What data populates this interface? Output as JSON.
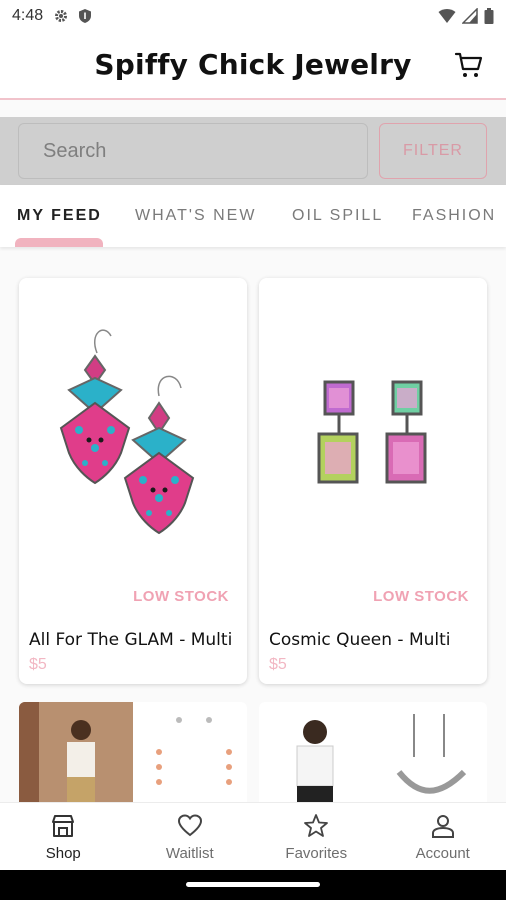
{
  "status_bar": {
    "time": "4:48"
  },
  "app_bar": {
    "title": "Spiffy Chick Jewelry"
  },
  "search": {
    "placeholder": "Search",
    "filter_label": "FILTER"
  },
  "tabs": [
    {
      "label": "MY FEED"
    },
    {
      "label": "WHAT'S NEW"
    },
    {
      "label": "OIL SPILL"
    },
    {
      "label": "FASHION"
    }
  ],
  "products": [
    {
      "name": "All For The GLAM - Multi",
      "price": "$5",
      "stock": "LOW STOCK"
    },
    {
      "name": "Cosmic Queen - Multi",
      "price": "$5",
      "stock": "LOW STOCK"
    }
  ],
  "bottom_nav": [
    {
      "label": "Shop",
      "icon": "shop-icon"
    },
    {
      "label": "Waitlist",
      "icon": "heart-icon"
    },
    {
      "label": "Favorites",
      "icon": "star-icon"
    },
    {
      "label": "Account",
      "icon": "person-icon"
    }
  ],
  "colors": {
    "accent_pink": "#f1b3bf",
    "low_stock": "#f0a2b3"
  }
}
